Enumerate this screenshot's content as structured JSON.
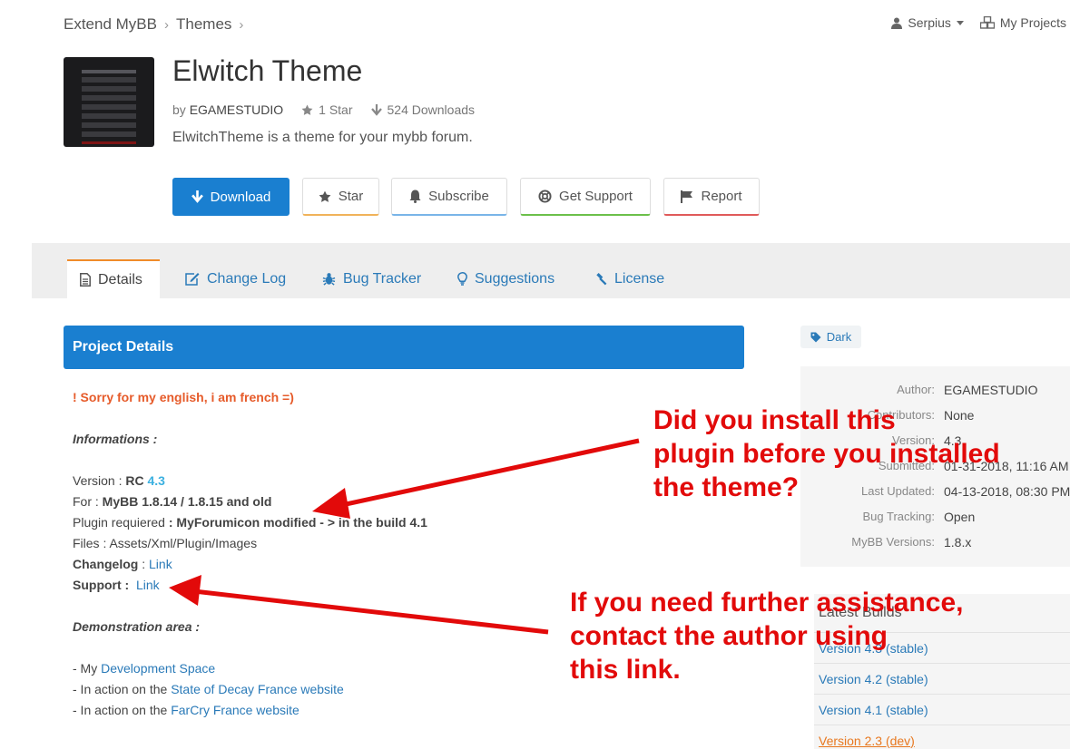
{
  "breadcrumb": {
    "root": "Extend MyBB",
    "themes": "Themes"
  },
  "user_nav": {
    "username": "Serpius",
    "projects": "My Projects"
  },
  "project": {
    "title": "Elwitch Theme",
    "by_label": "by",
    "author": "EGAMESTUDIO",
    "stars": "1 Star",
    "downloads": "524 Downloads",
    "description": "ElwitchTheme is a theme for your mybb forum."
  },
  "actions": {
    "download": "Download",
    "star": "Star",
    "subscribe": "Subscribe",
    "support": "Get Support",
    "report": "Report"
  },
  "tabs": [
    {
      "label": "Details"
    },
    {
      "label": "Change Log"
    },
    {
      "label": "Bug Tracker"
    },
    {
      "label": "Suggestions"
    },
    {
      "label": "License"
    }
  ],
  "details": {
    "heading": "Project Details",
    "warning": "! Sorry for my english, i am french =)",
    "informations": "Informations :",
    "version_label": "Version : ",
    "version_rc": "RC",
    "version_num": "4.3",
    "for_label": "For : ",
    "for_value": "MyBB 1.8.14 / 1.8.15 and old",
    "plugin_label": "Plugin requiered ",
    "plugin_value": ": MyForumicon modified - > in the build 4.1",
    "files": "Files : Assets/Xml/Plugin/Images",
    "changelog_label": "Changelog",
    "changelog_sep": " : ",
    "changelog_link": "Link",
    "support_label": "Support :",
    "support_link": "Link",
    "demo_heading": "Demonstration area :",
    "demo_1_prefix": "- My ",
    "demo_1_link": "Development Space",
    "demo_2_prefix": "- In action on the ",
    "demo_2_link": "State of Decay France website",
    "demo_3_prefix": "- In action on the ",
    "demo_3_link": "FarCry France website"
  },
  "sidebar": {
    "tag": "Dark",
    "info": [
      {
        "label": "Author:",
        "value": "EGAMESTUDIO"
      },
      {
        "label": "Contributors:",
        "value": "None"
      },
      {
        "label": "Version:",
        "value": "4.3"
      },
      {
        "label": "Submitted:",
        "value": "01-31-2018, 11:16 AM"
      },
      {
        "label": "Last Updated:",
        "value": "04-13-2018, 08:30 PM"
      },
      {
        "label": "Bug Tracking:",
        "value": "Open"
      },
      {
        "label": "MyBB Versions:",
        "value": "1.8.x"
      }
    ],
    "builds_heading": "Latest Builds",
    "builds": [
      {
        "label": "Version 4.3 (stable)"
      },
      {
        "label": "Version 4.2 (stable)"
      },
      {
        "label": "Version 4.1 (stable)"
      },
      {
        "label": "Version 2.3 (dev)"
      }
    ]
  },
  "annotations": {
    "note_1": [
      "Did you install this",
      "plugin before you installed",
      "the theme?"
    ],
    "note_2": [
      "If you need further assistance,",
      "contact the author using",
      "this link."
    ],
    "color": "#e20a0a"
  },
  "colors": {
    "primary": "#1a7fd0",
    "link": "#2a7ab8",
    "warning": "#e65b2a",
    "active_tab": "#f08c2a"
  }
}
